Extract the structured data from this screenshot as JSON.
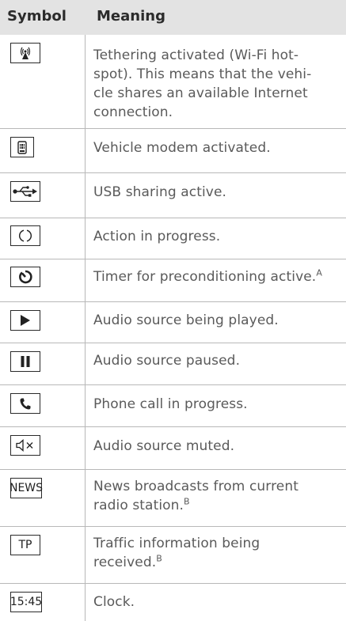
{
  "header": {
    "symbol": "Symbol",
    "meaning": "Meaning"
  },
  "rows": [
    {
      "icon": "wifi-hotspot-icon",
      "lines": [
        "Tethering activated (Wi-Fi hot-",
        "spot). This means that the vehi-",
        "cle shares an available Internet",
        "connection."
      ]
    },
    {
      "icon": "vehicle-modem-icon",
      "lines": [
        "Vehicle modem activated."
      ]
    },
    {
      "icon": "usb-icon",
      "lines": [
        "USB sharing active."
      ]
    },
    {
      "icon": "action-progress-icon",
      "lines": [
        "Action in progress."
      ]
    },
    {
      "icon": "timer-icon",
      "lines": [
        "Timer for preconditioning active."
      ],
      "sup": "A"
    },
    {
      "icon": "play-icon",
      "lines": [
        "Audio source being played."
      ]
    },
    {
      "icon": "pause-icon",
      "lines": [
        "Audio source paused."
      ]
    },
    {
      "icon": "phone-icon",
      "lines": [
        "Phone call in progress."
      ]
    },
    {
      "icon": "mute-icon",
      "lines": [
        "Audio source muted."
      ]
    },
    {
      "icon": "news-icon",
      "symbol_text": "NEWS",
      "lines": [
        "News broadcasts from current",
        "radio station."
      ],
      "sup": "B"
    },
    {
      "icon": "tp-icon",
      "symbol_text": "TP",
      "lines": [
        "Traffic information being",
        "received."
      ],
      "sup": "B"
    },
    {
      "icon": "clock-icon",
      "symbol_text": "15:45",
      "lines": [
        "Clock."
      ]
    }
  ]
}
